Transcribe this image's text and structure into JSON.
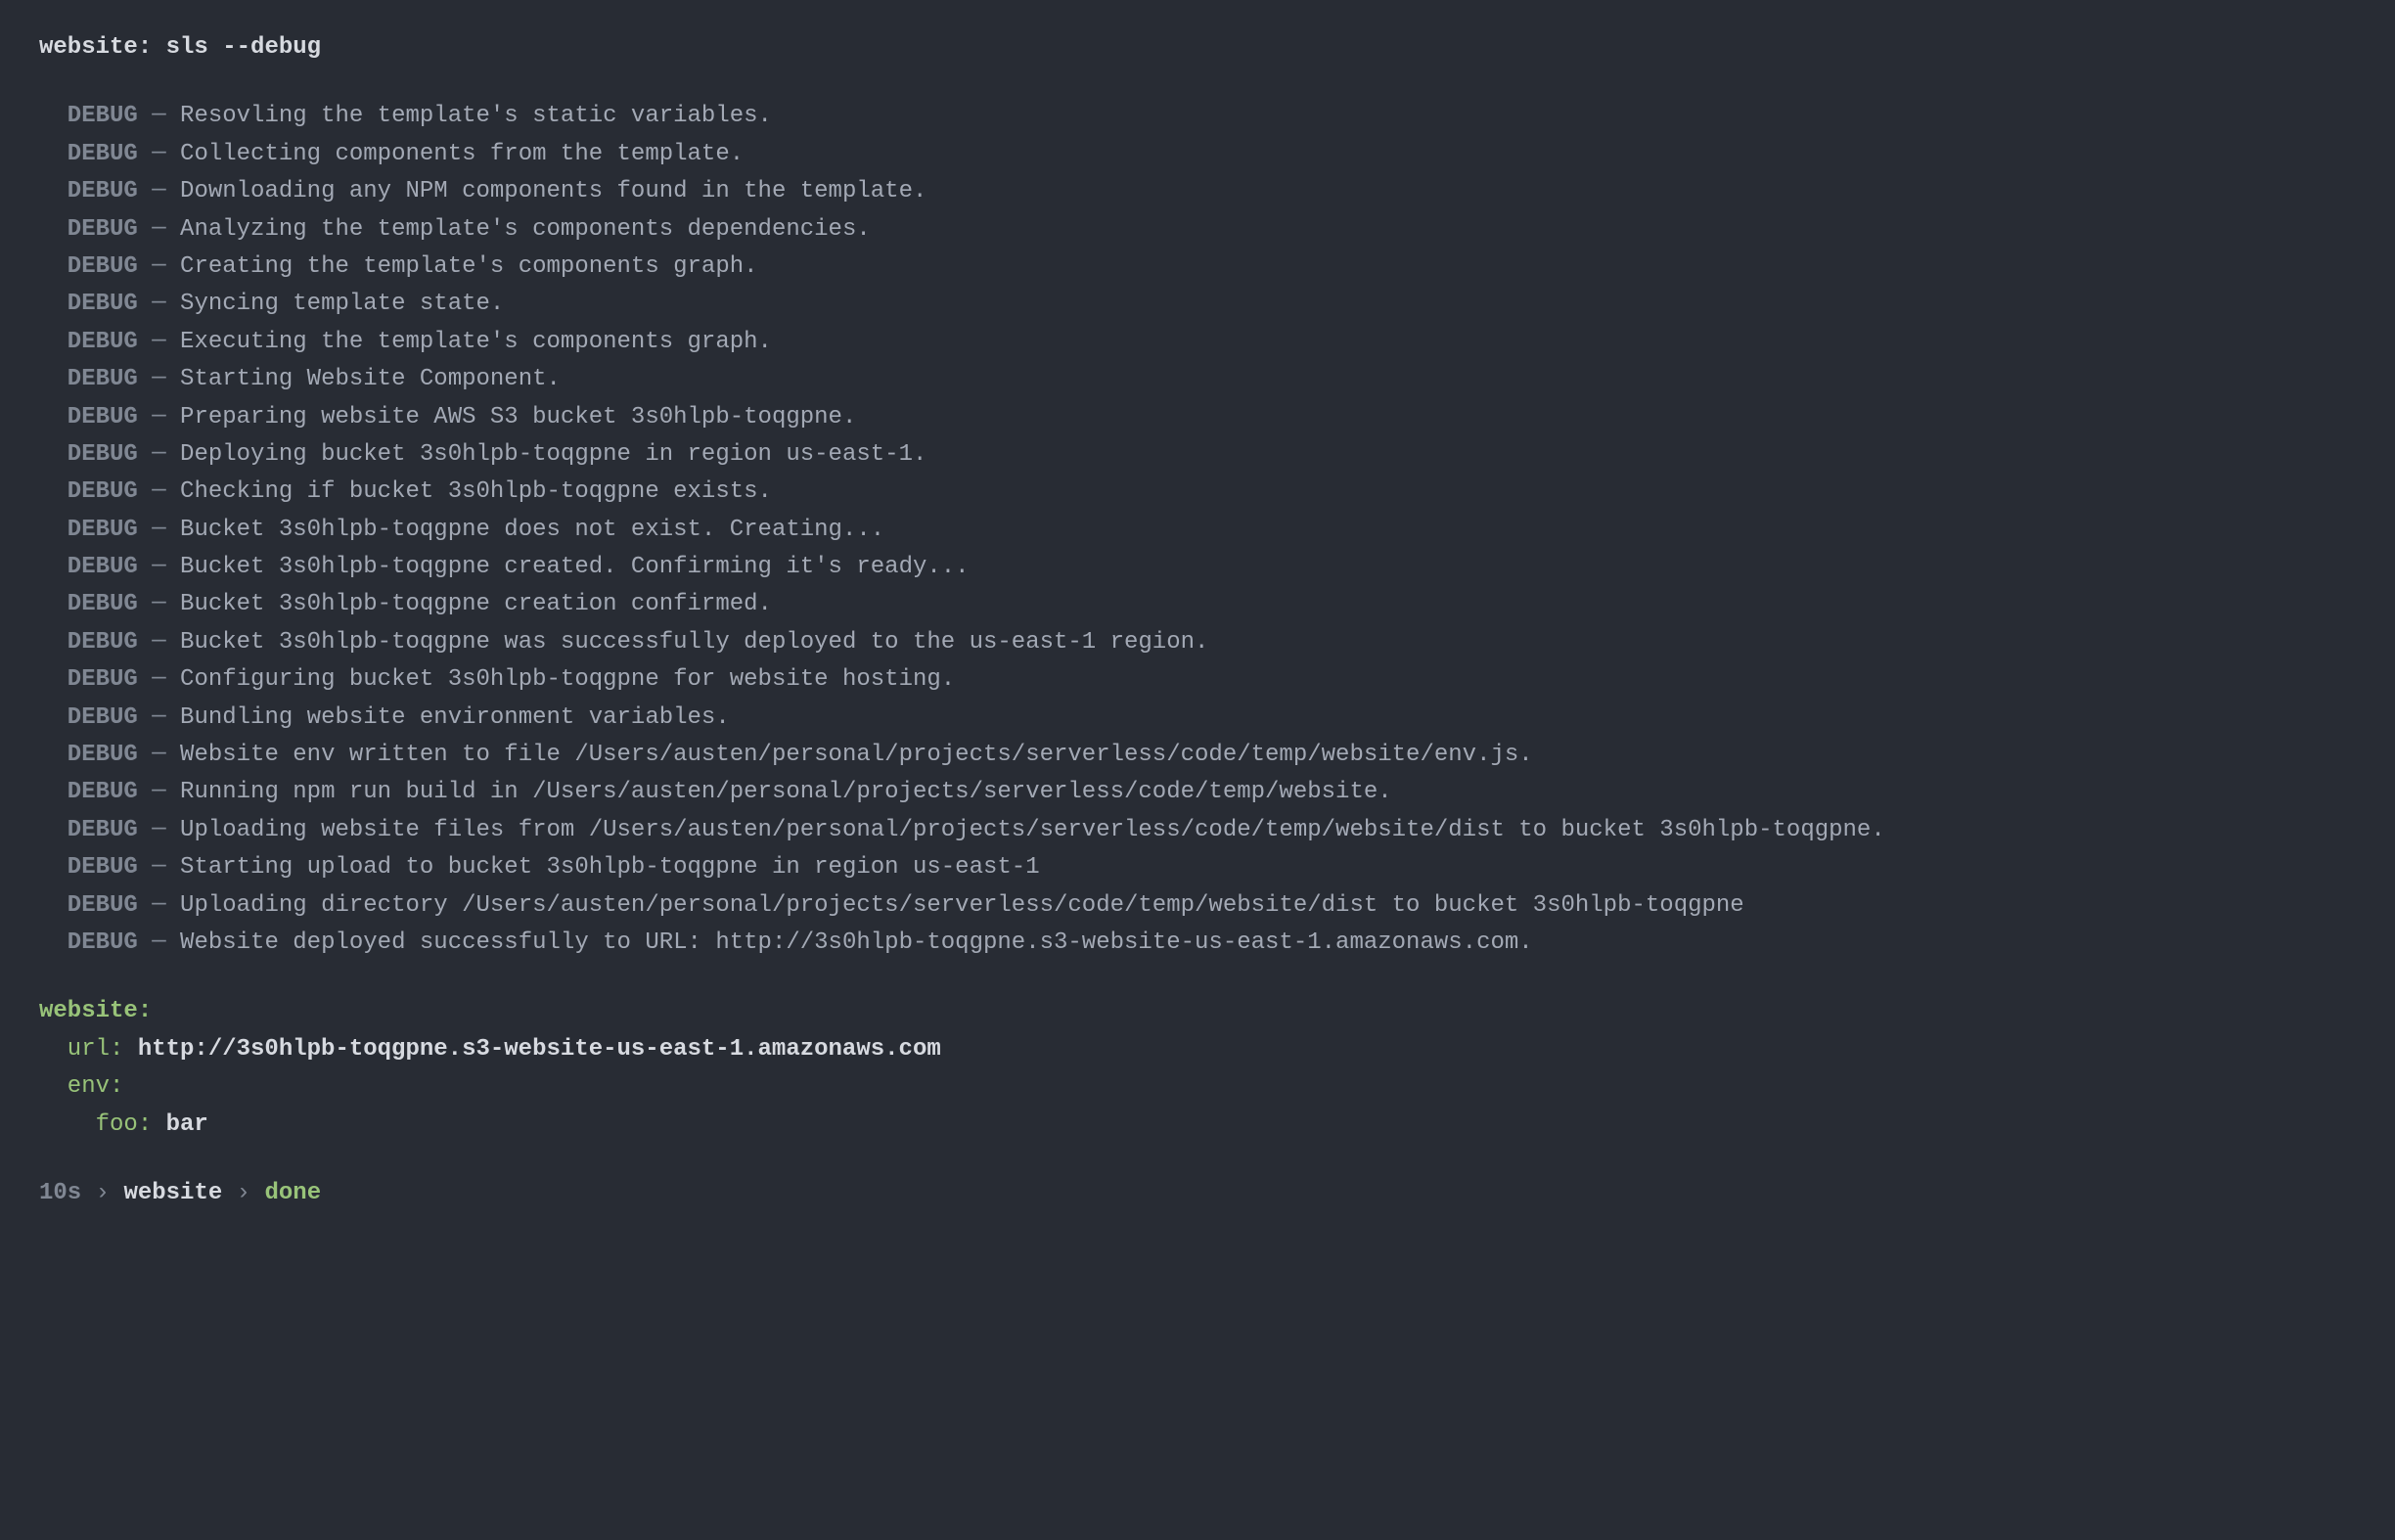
{
  "command": "website: sls --debug",
  "debug_lines": [
    "Resovling the template's static variables.",
    "Collecting components from the template.",
    "Downloading any NPM components found in the template.",
    "Analyzing the template's components dependencies.",
    "Creating the template's components graph.",
    "Syncing template state.",
    "Executing the template's components graph.",
    "Starting Website Component.",
    "Preparing website AWS S3 bucket 3s0hlpb-toqgpne.",
    "Deploying bucket 3s0hlpb-toqgpne in region us-east-1.",
    "Checking if bucket 3s0hlpb-toqgpne exists.",
    "Bucket 3s0hlpb-toqgpne does not exist. Creating...",
    "Bucket 3s0hlpb-toqgpne created. Confirming it's ready...",
    "Bucket 3s0hlpb-toqgpne creation confirmed.",
    "Bucket 3s0hlpb-toqgpne was successfully deployed to the us-east-1 region.",
    "Configuring bucket 3s0hlpb-toqgpne for website hosting.",
    "Bundling website environment variables.",
    "Website env written to file /Users/austen/personal/projects/serverless/code/temp/website/env.js.",
    "Running npm run build in /Users/austen/personal/projects/serverless/code/temp/website.",
    "Uploading website files from /Users/austen/personal/projects/serverless/code/temp/website/dist to bucket 3s0hlpb-toqgpne.",
    "Starting upload to bucket 3s0hlpb-toqgpne in region us-east-1",
    "Uploading directory /Users/austen/personal/projects/serverless/code/temp/website/dist to bucket 3s0hlpb-toqgpne",
    "Website deployed successfully to URL: http://3s0hlpb-toqgpne.s3-website-us-east-1.amazonaws.com."
  ],
  "debug_tag": "DEBUG",
  "output": {
    "website_label": "website:",
    "url_label": "url:",
    "url_value": "http://3s0hlpb-toqgpne.s3-website-us-east-1.amazonaws.com",
    "env_label": "env:",
    "foo_label": "foo:",
    "foo_value": "bar"
  },
  "status": {
    "duration": "10s",
    "component": "website",
    "state": "done",
    "sep": "›"
  }
}
